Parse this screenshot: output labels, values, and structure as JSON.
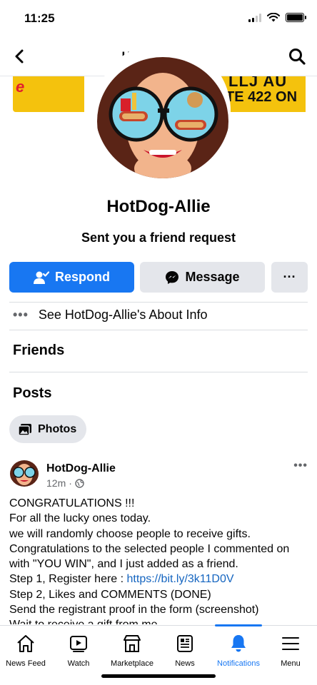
{
  "status_bar": {
    "time": "11:25"
  },
  "nav": {
    "title": "HotDog-Allie",
    "back_icon": "chevron-left-icon",
    "search_icon": "search-icon"
  },
  "cover": {
    "left_text": "e",
    "right_line1": "LLJ AU",
    "right_line2": "TE 422 ON"
  },
  "profile": {
    "name": "HotDog-Allie",
    "subtitle": "Sent you a friend request"
  },
  "actions": {
    "respond_label": "Respond",
    "message_label": "Message",
    "more_label": "···"
  },
  "about": {
    "dots": "•••",
    "label": "See HotDog-Allie's About Info"
  },
  "sections": {
    "friends": "Friends",
    "posts": "Posts"
  },
  "photos_chip": {
    "label": "Photos"
  },
  "post": {
    "author": "HotDog-Allie",
    "time": "12m",
    "separator": "·",
    "menu": "•••",
    "lines": [
      "CONGRATULATIONS !!!",
      "For all the lucky ones today.",
      "we will randomly choose people to receive gifts.",
      "Congratulations to the selected people I commented on",
      "with \"YOU WIN\", and I just added as a friend."
    ],
    "step1_prefix": "Step 1, Register here : ",
    "step1_link": "https://bit.ly/3k11D0V",
    "lines_after": [
      "Step 2, Likes and COMMENTS (DONE)",
      "Send the registrant proof in the form (screenshot)",
      "Wait to receive a gift from me"
    ]
  },
  "tabbar": {
    "tabs": [
      {
        "label": "News Feed",
        "icon": "home-icon"
      },
      {
        "label": "Watch",
        "icon": "play-icon"
      },
      {
        "label": "Marketplace",
        "icon": "shop-icon"
      },
      {
        "label": "News",
        "icon": "newspaper-icon"
      },
      {
        "label": "Notifications",
        "icon": "bell-icon",
        "active": true
      },
      {
        "label": "Menu",
        "icon": "menu-icon"
      }
    ]
  },
  "colors": {
    "accent": "#1877f2",
    "chip_gray": "#e4e6eb",
    "link": "#1565c0",
    "cover_yellow": "#f4c20d"
  }
}
